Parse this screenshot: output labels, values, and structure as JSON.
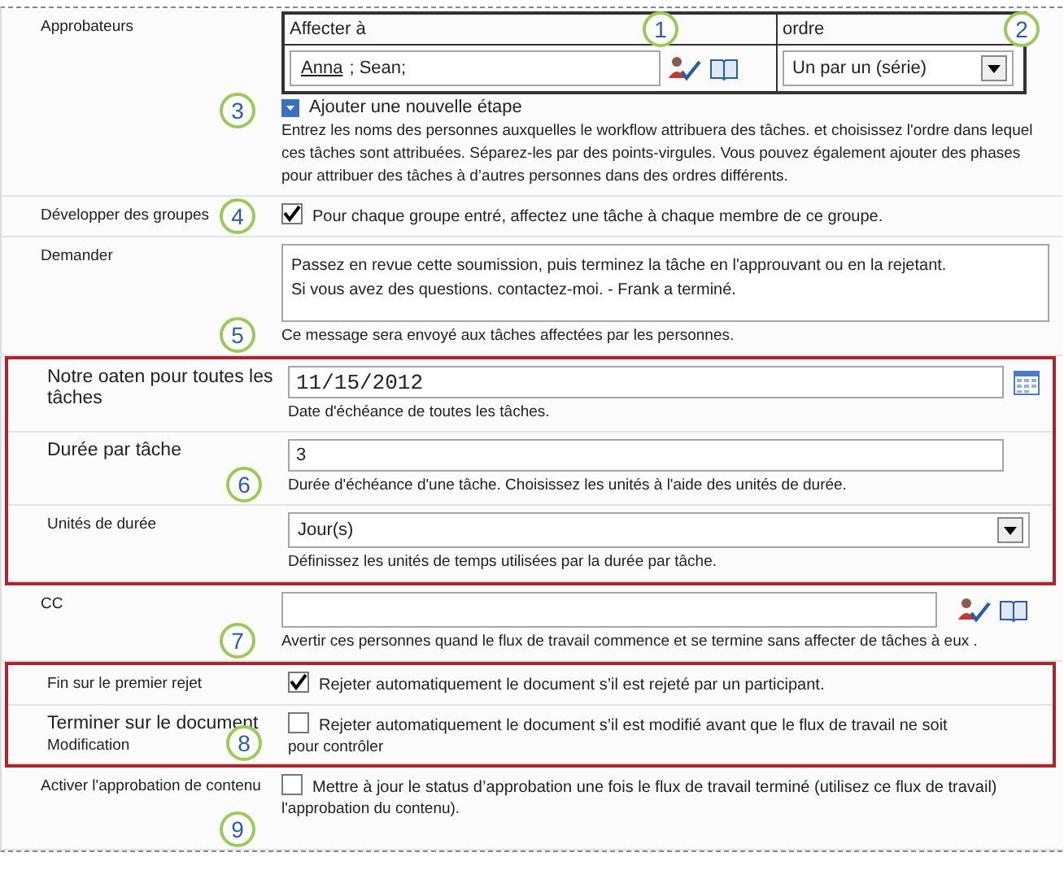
{
  "groups": [
    {
      "highlighted": false,
      "rows": [
        {
          "kind": "approvers",
          "label": "Approbateurs",
          "assign_header": "Affecter à",
          "people": [
            {
              "name": "Anna",
              "resolved": true
            },
            {
              "name": "; Sean;",
              "resolved": false
            }
          ],
          "order_header": "ordre",
          "order_value": "Un par un (série)",
          "add_stage": "Ajouter une nouvelle étape",
          "help": "Entrez les noms des personnes auxquelles le workflow attribuera des tâches. et choisissez l'ordre dans lequel ces tâches sont attribuées. Séparez-les par des points-virgules. Vous pouvez également ajouter des phases pour attribuer des tâches à d’autres personnes dans des ordres différents.",
          "callouts": [
            "1",
            "2",
            "3"
          ]
        },
        {
          "kind": "checkbox",
          "label": "Développer des groupes",
          "checked": true,
          "text": "Pour chaque groupe entré, affectez une tâche à chaque membre de ce groupe.",
          "callouts": [
            "4"
          ]
        },
        {
          "kind": "textarea",
          "label": "Demander",
          "value": "Passez en revue cette soumission, puis terminez la tâche en l'approuvant ou en la rejetant. Si vous avez des questions. contactez-moi. - Frank a terminé.",
          "help": "Ce message sera envoyé aux tâches affectées par les personnes.",
          "callouts": [
            "5"
          ]
        }
      ]
    },
    {
      "highlighted": true,
      "rows": [
        {
          "kind": "date",
          "label": "Notre oaten pour toutes les tâches",
          "value": "11/15/2012",
          "help": "Date d'échéance de toutes les tâches."
        },
        {
          "kind": "text",
          "label": "Durée par tâche",
          "value": "3",
          "help": "Durée d'échéance d'une tâche. Choisissez les unités à l'aide des unités de durée.",
          "callouts": [
            "6"
          ]
        },
        {
          "kind": "select",
          "label": "Unités de durée",
          "value": "Jour(s)",
          "help": "Définissez les unités de temps utilisées par la durée par tâche."
        }
      ]
    },
    {
      "highlighted": false,
      "rows": [
        {
          "kind": "people",
          "label": "CC",
          "help": "Avertir ces personnes quand le flux de travail commence et se termine sans affecter de tâches à eux .",
          "callouts": [
            "7"
          ]
        }
      ]
    },
    {
      "highlighted": true,
      "rows": [
        {
          "kind": "checkbox",
          "label": "Fin sur le premier rejet",
          "checked": true,
          "text": "Rejeter automatiquement le document s’il est rejeté par un participant."
        },
        {
          "kind": "checkbox",
          "label": "Terminer sur le document",
          "sublabel": "Modification",
          "checked": false,
          "text": "Rejeter automatiquement le document s’il est modifié avant que le flux de travail ne soit",
          "note": "pour contrôler",
          "callouts": [
            "8"
          ]
        }
      ]
    },
    {
      "highlighted": false,
      "rows": [
        {
          "kind": "checkbox",
          "label": "Activer l'approbation de contenu",
          "checked": false,
          "text": "Mettre à jour le status d’approbation une fois le flux de travail terminé (utilisez ce flux de travail)",
          "note": "l'approbation du contenu).",
          "callouts": [
            "9"
          ]
        }
      ]
    }
  ]
}
